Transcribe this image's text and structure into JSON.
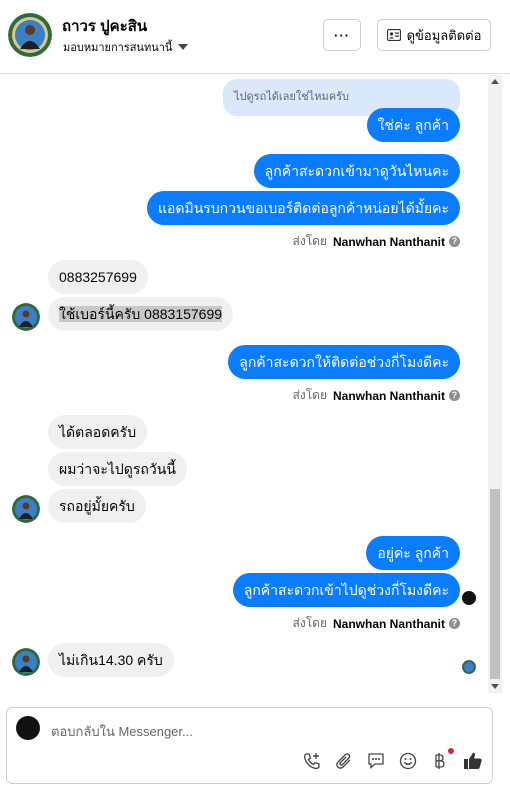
{
  "header": {
    "name": "ถาวร ปูคะสิน",
    "assign_label": "มอบหมายการสนทนานี้",
    "more_label": "···",
    "contact_label": "ดูข้อมูลติดต่อ"
  },
  "messages": {
    "quoted": "ไปดูรถได้เลยใช่ไหมครับ",
    "m1": "ใช่ค่ะ ลูกค้า",
    "m2": "ลูกค้าสะดวกเข้ามาดูวันไหนคะ",
    "m3": "แอดมินรบกวนขอเบอร์ติดต่อลูกค้าหน่อยได้มั้ยคะ",
    "m4": "0883257699",
    "m5": "ใช้เบอร์นี้ครับ 0883157699",
    "m6": "ลูกค้าสะดวกให้ติดต่อช่วงกี่โมงดีคะ",
    "m7": "ได้ตลอดครับ",
    "m8": "ผมว่าจะไปดูรถวันนี้",
    "m9": "รถอยู่มั้ยครับ",
    "m10": "อยู่ค่ะ ลูกค้า",
    "m11": "ลูกค้าสะดวกเข้าไปดูช่วงกี่โมงดีคะ",
    "m12": "ไม่เกิน14.30 ครับ"
  },
  "sent_by": {
    "prefix": "ส่งโดย",
    "sender": "Nanwhan Nanthanit"
  },
  "composer": {
    "placeholder": "ตอบกลับใน Messenger..."
  },
  "colors": {
    "outgoing": "#0a7cff",
    "incoming": "#f0f0f0"
  },
  "icons": [
    "more-icon",
    "contact-card-icon",
    "chevron-down-icon",
    "help-icon",
    "add-call-icon",
    "attach-icon",
    "chat-bubble-icon",
    "emoji-icon",
    "baht-icon",
    "like-icon"
  ]
}
